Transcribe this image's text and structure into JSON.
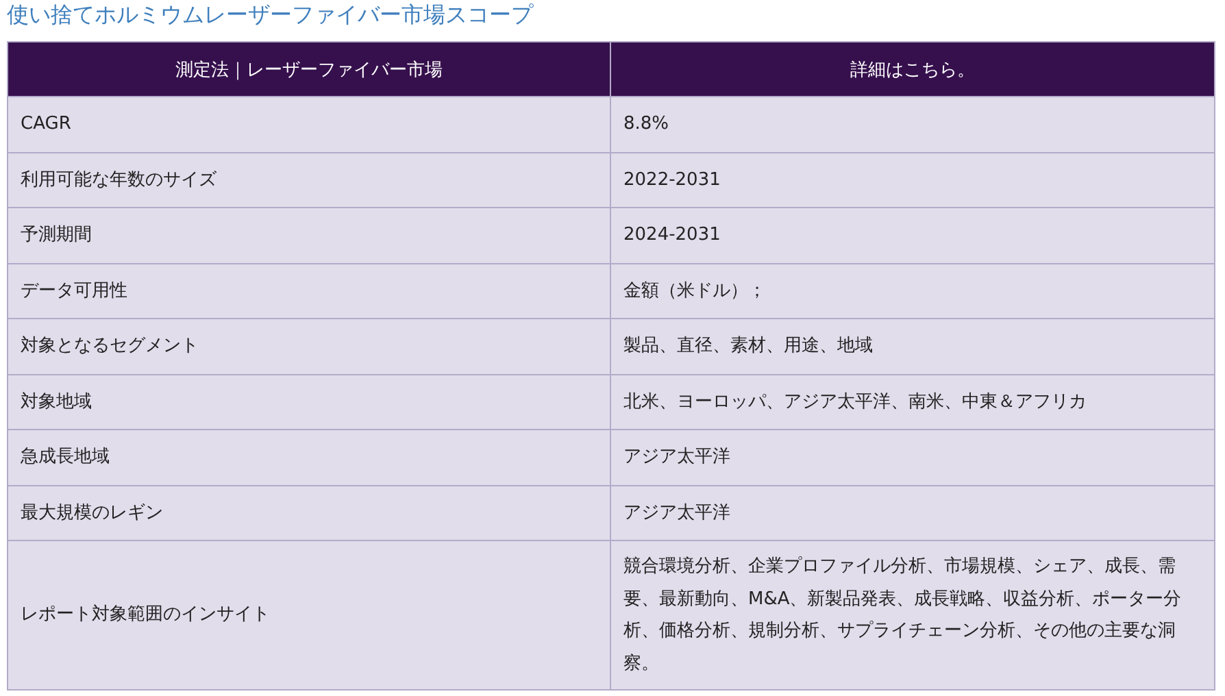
{
  "title": "使い捨てホルミウムレーザーファイバー市場スコープ",
  "table": {
    "columns": [
      "測定法｜レーザーファイバー市場",
      "詳細はこちら。"
    ],
    "rows": [
      [
        "CAGR",
        "8.8%"
      ],
      [
        "利用可能な年数のサイズ",
        "2022-2031"
      ],
      [
        "予測期間",
        "2024-2031"
      ],
      [
        "データ可用性",
        "金額（米ドル）；"
      ],
      [
        "対象となるセグメント",
        "製品、直径、素材、用途、地域"
      ],
      [
        "対象地域",
        "北米、ヨーロッパ、アジア太平洋、南米、中東＆アフリカ"
      ],
      [
        "急成長地域",
        "アジア太平洋"
      ],
      [
        "最大規模のレギン",
        "アジア太平洋"
      ],
      [
        "レポート対象範囲のインサイト",
        "競合環境分析、企業プロファイル分析、市場規模、シェア、成長、需要、最新動向、M&A、新製品発表、成長戦略、収益分析、ポーター分析、価格分析、規制分析、サプライチェーン分析、その他の主要な洞察。"
      ]
    ]
  }
}
